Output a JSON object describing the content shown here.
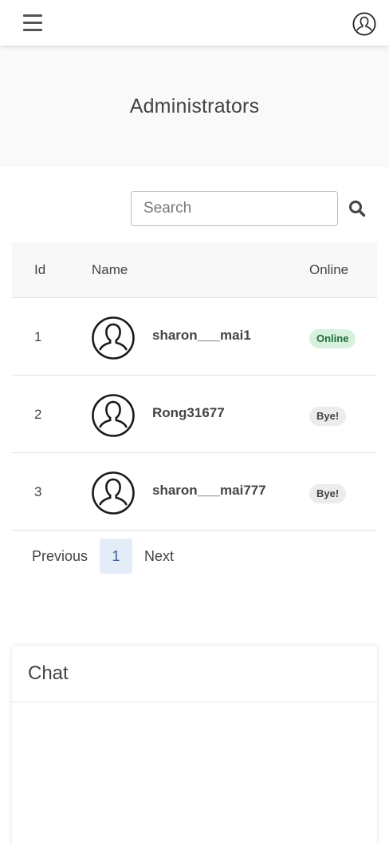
{
  "page": {
    "title": "Administrators"
  },
  "search": {
    "placeholder": "Search",
    "value": ""
  },
  "table": {
    "headers": {
      "id": "Id",
      "name": "Name",
      "online": "Online"
    },
    "rows": [
      {
        "id": "1",
        "name": "sharon___mai1",
        "status": "Online",
        "status_type": "online"
      },
      {
        "id": "2",
        "name": "Rong31677",
        "status": "Bye!",
        "status_type": "offline"
      },
      {
        "id": "3",
        "name": "sharon___mai777",
        "status": "Bye!",
        "status_type": "offline"
      }
    ]
  },
  "pagination": {
    "previous": "Previous",
    "current": "1",
    "next": "Next"
  },
  "chat": {
    "title": "Chat"
  },
  "icons": {
    "menu": "hamburger-menu-icon",
    "account": "user-account-icon",
    "search": "search-icon",
    "avatar": "user-avatar-icon"
  },
  "colors": {
    "online_badge_bg": "#d6f2de",
    "online_badge_text": "#1f6b3a",
    "bye_badge_bg": "#ececec",
    "active_page_bg": "#e4ecf8",
    "active_page_text": "#3b5f9e"
  }
}
